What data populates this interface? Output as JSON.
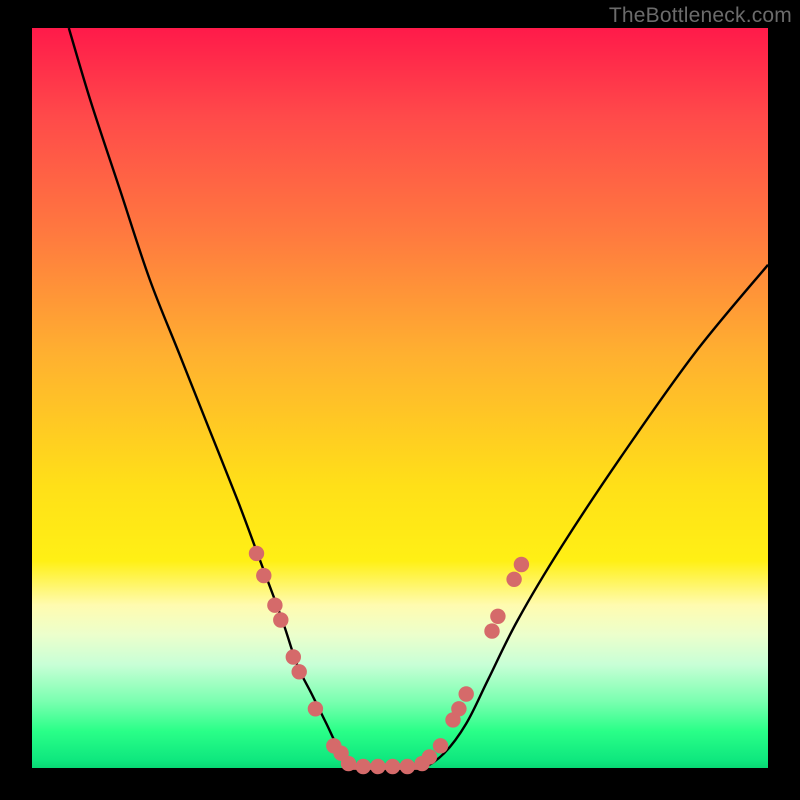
{
  "watermark": "TheBottleneck.com",
  "chart_data": {
    "type": "line",
    "title": "",
    "xlabel": "",
    "ylabel": "",
    "xlim": [
      0,
      100
    ],
    "ylim": [
      0,
      100
    ],
    "grid": false,
    "series": [
      {
        "name": "bottleneck-curve",
        "color": "#000000",
        "x": [
          5,
          8,
          12,
          16,
          20,
          24,
          28,
          31,
          34,
          36,
          38,
          40,
          42,
          44,
          47,
          50,
          53,
          56,
          59,
          62,
          66,
          72,
          80,
          90,
          100
        ],
        "y": [
          100,
          90,
          78,
          66,
          56,
          46,
          36,
          28,
          20,
          14,
          10,
          6,
          2,
          0,
          0,
          0,
          0,
          2,
          6,
          12,
          20,
          30,
          42,
          56,
          68
        ]
      }
    ],
    "scatter": {
      "name": "sample-points",
      "color": "#d56a6a",
      "radius_pct": 1.05,
      "points": [
        {
          "x": 30.5,
          "y": 29.0
        },
        {
          "x": 31.5,
          "y": 26.0
        },
        {
          "x": 33.0,
          "y": 22.0
        },
        {
          "x": 33.8,
          "y": 20.0
        },
        {
          "x": 35.5,
          "y": 15.0
        },
        {
          "x": 36.3,
          "y": 13.0
        },
        {
          "x": 38.5,
          "y": 8.0
        },
        {
          "x": 41.0,
          "y": 3.0
        },
        {
          "x": 42.0,
          "y": 2.0
        },
        {
          "x": 43.0,
          "y": 0.6
        },
        {
          "x": 45.0,
          "y": 0.2
        },
        {
          "x": 47.0,
          "y": 0.2
        },
        {
          "x": 49.0,
          "y": 0.2
        },
        {
          "x": 51.0,
          "y": 0.2
        },
        {
          "x": 53.0,
          "y": 0.6
        },
        {
          "x": 54.0,
          "y": 1.5
        },
        {
          "x": 55.5,
          "y": 3.0
        },
        {
          "x": 57.2,
          "y": 6.5
        },
        {
          "x": 58.0,
          "y": 8.0
        },
        {
          "x": 59.0,
          "y": 10.0
        },
        {
          "x": 62.5,
          "y": 18.5
        },
        {
          "x": 63.3,
          "y": 20.5
        },
        {
          "x": 65.5,
          "y": 25.5
        },
        {
          "x": 66.5,
          "y": 27.5
        }
      ]
    },
    "flat_band": {
      "name": "optimal-range-band",
      "color": "#d56a6a",
      "x0": 43,
      "x1": 53,
      "y": 0.2,
      "thickness_pct": 0.9
    }
  }
}
